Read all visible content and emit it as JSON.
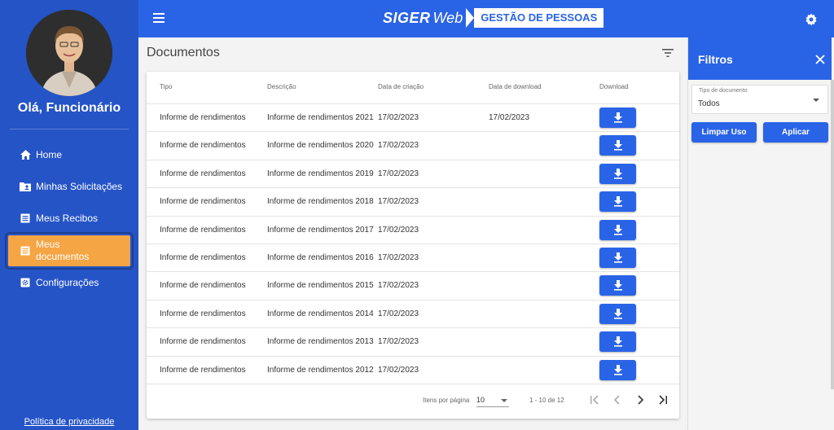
{
  "colors": {
    "sidebar": "#2554c7",
    "topbar": "#2a64e6",
    "active": "#f5a544",
    "button": "#2a64e6"
  },
  "sidebar": {
    "greeting": "Olá, Funcionário",
    "items": [
      {
        "label": "Home",
        "icon": "home-icon"
      },
      {
        "label": "Minhas Solicitações",
        "icon": "folder-user-icon"
      },
      {
        "label": "Meus Recibos",
        "icon": "list-icon"
      },
      {
        "label": "Meus documentos",
        "icon": "list-icon",
        "active": true
      },
      {
        "label": "Configurações",
        "icon": "settings-icon"
      }
    ],
    "privacy": "Política de privacidade"
  },
  "topbar": {
    "logo_siger": "SIGER",
    "logo_web": "Web",
    "logo_tagline": "GESTÃO DE PESSOAS"
  },
  "main": {
    "title": "Documentos",
    "table": {
      "headers": [
        "Tipo",
        "Descrição",
        "Data de criação",
        "Data de download",
        "Download"
      ],
      "rows": [
        [
          "Informe de rendimentos",
          "Informe de rendimentos 2021",
          "17/02/2023",
          "17/02/2023"
        ],
        [
          "Informe de rendimentos",
          "Informe de rendimentos 2020",
          "17/02/2023",
          ""
        ],
        [
          "Informe de rendimentos",
          "Informe de rendimentos 2019",
          "17/02/2023",
          ""
        ],
        [
          "Informe de rendimentos",
          "Informe de rendimentos 2018",
          "17/02/2023",
          ""
        ],
        [
          "Informe de rendimentos",
          "Informe de rendimentos 2017",
          "17/02/2023",
          ""
        ],
        [
          "Informe de rendimentos",
          "Informe de rendimentos 2016",
          "17/02/2023",
          ""
        ],
        [
          "Informe de rendimentos",
          "Informe de rendimentos 2015",
          "17/02/2023",
          ""
        ],
        [
          "Informe de rendimentos",
          "Informe de rendimentos 2014",
          "17/02/2023",
          ""
        ],
        [
          "Informe de rendimentos",
          "Informe de rendimentos 2013",
          "17/02/2023",
          ""
        ],
        [
          "Informe de rendimentos",
          "Informe de rendimentos 2012",
          "17/02/2023",
          ""
        ]
      ]
    },
    "paginator": {
      "label": "Itens por página",
      "page_size": "10",
      "range": "1 - 10 de 12"
    }
  },
  "filters": {
    "title": "Filtros",
    "doc_type_label": "Tipo de documento",
    "doc_type_value": "Todos",
    "clear_label": "Limpar Uso",
    "apply_label": "Aplicar"
  }
}
